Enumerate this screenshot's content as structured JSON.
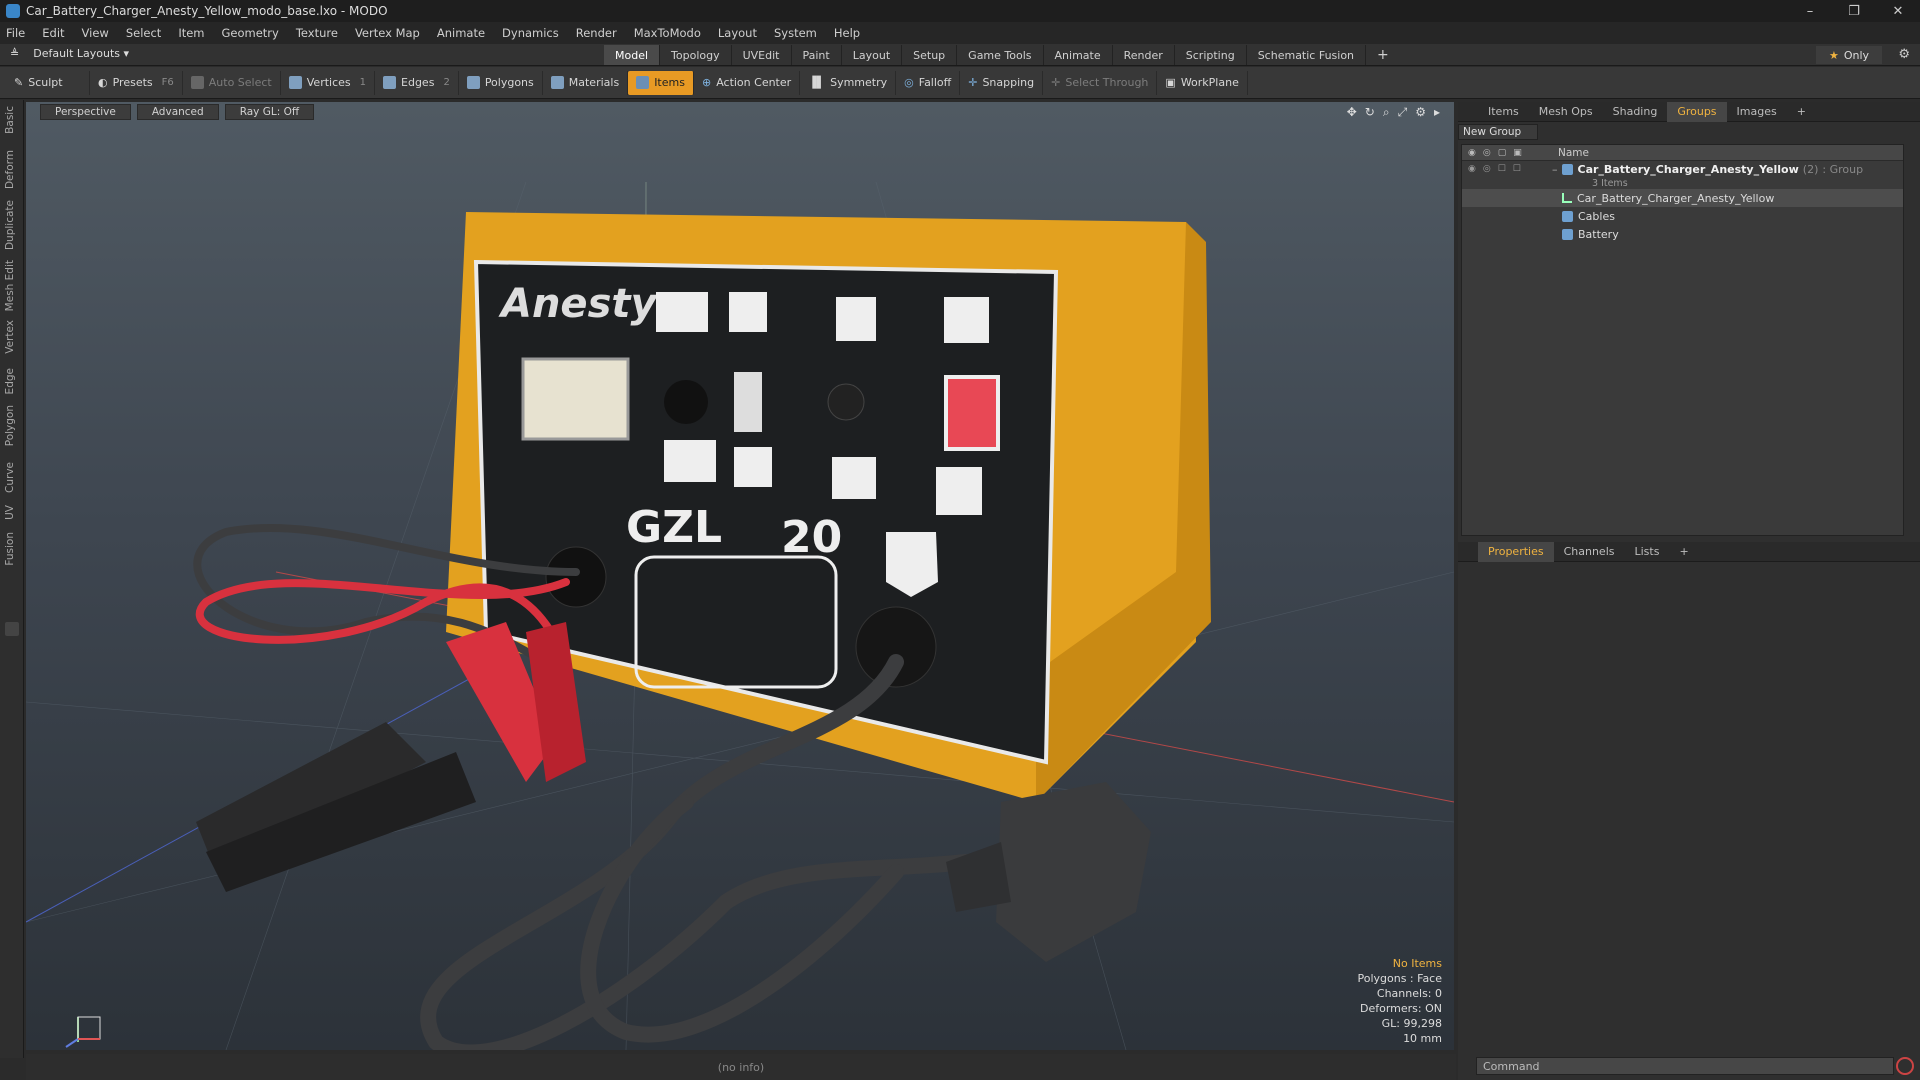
{
  "window": {
    "title": "Car_Battery_Charger_Anesty_Yellow_modo_base.lxo - MODO",
    "minimize": "–",
    "maximize": "❐",
    "close": "✕"
  },
  "menu": [
    "File",
    "Edit",
    "View",
    "Select",
    "Item",
    "Geometry",
    "Texture",
    "Vertex Map",
    "Animate",
    "Dynamics",
    "Render",
    "MaxToModo",
    "Layout",
    "System",
    "Help"
  ],
  "layout": {
    "layout_selector": "Default Layouts ▾",
    "tabs": [
      "Model",
      "Topology",
      "UVEdit",
      "Paint",
      "Layout",
      "Setup",
      "Game Tools",
      "Animate",
      "Render",
      "Scripting",
      "Schematic Fusion"
    ],
    "active_tab": "Model",
    "add": "+",
    "only_label": "Only"
  },
  "toolbar": {
    "sculpt": "Sculpt",
    "presets": "Presets",
    "presets_key": "F6",
    "auto_select": "Auto Select",
    "vertices": "Vertices",
    "vertices_key": "1",
    "edges": "Edges",
    "edges_key": "2",
    "polygons": "Polygons",
    "materials": "Materials",
    "items": "Items",
    "action_center": "Action Center",
    "symmetry": "Symmetry",
    "falloff": "Falloff",
    "snapping": "Snapping",
    "select_through": "Select Through",
    "workplane": "WorkPlane"
  },
  "left_tabs": [
    "Basic",
    "Deform",
    "Duplicate",
    "Mesh Edit",
    "Vertex",
    "Edge",
    "Polygon",
    "Curve",
    "UV",
    "Fusion"
  ],
  "viewport": {
    "view": "Perspective",
    "shading": "Advanced",
    "raygl": "Ray GL: Off",
    "info": {
      "no_items": "No Items",
      "polygons": "Polygons : Face",
      "channels": "Channels: 0",
      "deformers": "Deformers: ON",
      "gl": "GL: 99,298",
      "scale": "10 mm"
    },
    "colors": {
      "charger_body": "#e3a11f",
      "faceplate": "#1d1f21",
      "cable": "#3c3d3f",
      "red_clamp": "#d8313e",
      "black_clamp": "#2a2a2b"
    }
  },
  "status": "(no info)",
  "right_panel": {
    "tabs": [
      "Items",
      "Mesh Ops",
      "Shading",
      "Groups",
      "Images"
    ],
    "active_tab": "Groups",
    "new_group": "New Group",
    "column_name": "Name",
    "group": {
      "name": "Car_Battery_Charger_Anesty_Yellow",
      "count": "(2)",
      "type": ": Group",
      "sub": "3 Items",
      "children": [
        "Car_Battery_Charger_Anesty_Yellow",
        "Cables",
        "Battery"
      ]
    },
    "bottom_tabs": [
      "Properties",
      "Channels",
      "Lists"
    ],
    "bottom_active": "Properties",
    "command_placeholder": "Command"
  }
}
